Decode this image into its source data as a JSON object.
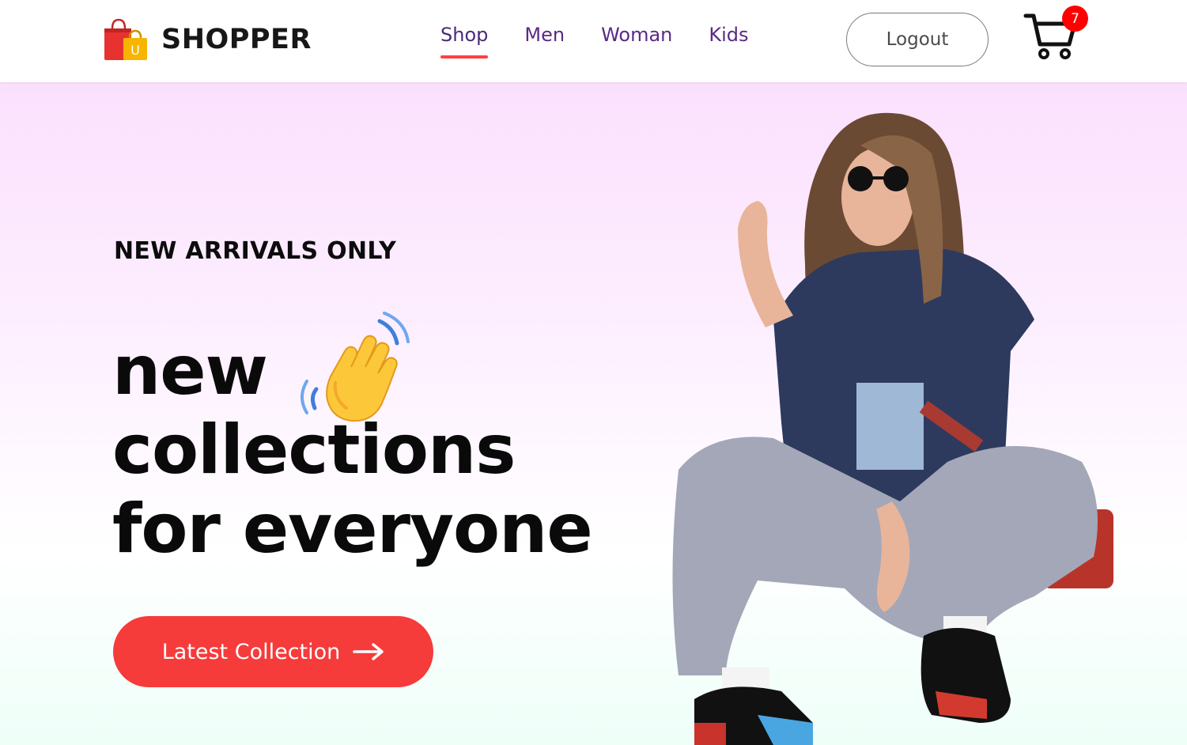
{
  "nav": {
    "brand": "SHOPPER",
    "logo_letter": "U",
    "items": [
      {
        "label": "Shop",
        "active": true
      },
      {
        "label": "Men",
        "active": false
      },
      {
        "label": "Woman",
        "active": false
      },
      {
        "label": "Kids",
        "active": false
      }
    ],
    "logout_label": "Logout",
    "cart_count": "7"
  },
  "hero": {
    "eyebrow": "NEW ARRIVALS ONLY",
    "headline_line1": "new",
    "headline_line2": "collections",
    "headline_line3": "for everyone",
    "cta_label": "Latest Collection",
    "wave_icon": "waving-hand-icon",
    "arrow_icon": "arrow-right-icon"
  },
  "colors": {
    "accent": "#ff4141",
    "cta": "#f63b3b",
    "nav_text": "#5a2a86",
    "badge": "#ff0000",
    "hero_gradient_top": "#fbe0fd",
    "hero_gradient_bottom": "#eefff8"
  }
}
